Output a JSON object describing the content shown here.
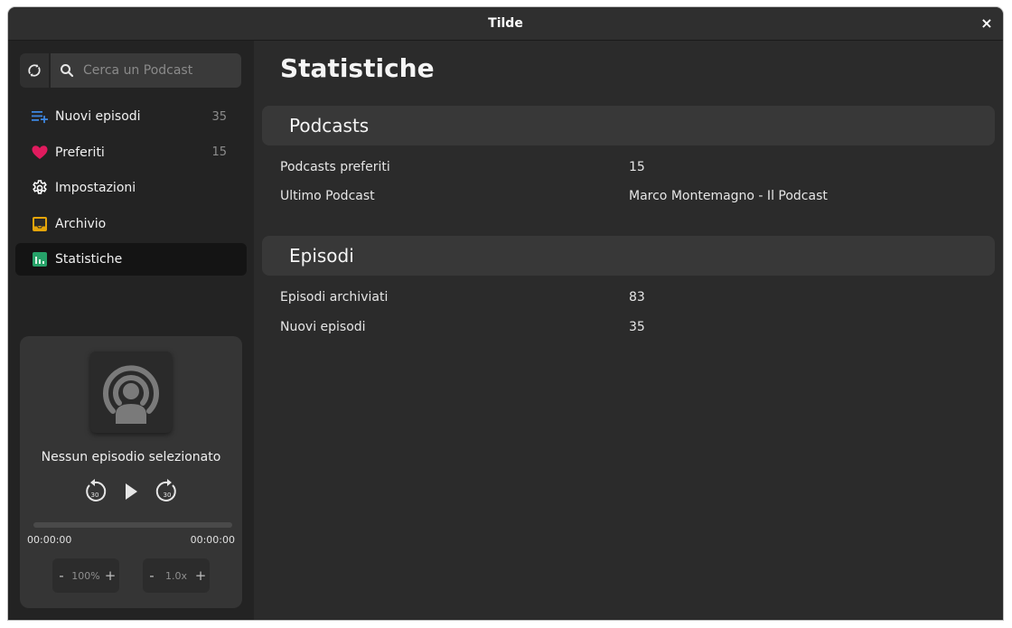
{
  "window": {
    "title": "Tilde",
    "close_symbol": "×"
  },
  "search": {
    "placeholder": "Cerca un Podcast"
  },
  "sidebar": {
    "items": [
      {
        "label": "Nuovi episodi",
        "count": "35",
        "icon": "new-episodes-icon",
        "color": "#3d86e0"
      },
      {
        "label": "Preferiti",
        "count": "15",
        "icon": "heart-icon",
        "color": "#e01b5e"
      },
      {
        "label": "Impostazioni",
        "count": "",
        "icon": "gear-icon",
        "color": "#ffffff"
      },
      {
        "label": "Archivio",
        "count": "",
        "icon": "inbox-icon",
        "color": "#e5a50a"
      },
      {
        "label": "Statistiche",
        "count": "",
        "icon": "stats-icon",
        "color": "#26a269",
        "active": true
      }
    ]
  },
  "player": {
    "episode_title": "Nessun episodio selezionato",
    "skip_back_label": "30",
    "skip_forward_label": "30",
    "current_time": "00:00:00",
    "total_time": "00:00:00",
    "progress": 0,
    "volume": "100%",
    "speed": "1.0x",
    "minus": "-",
    "plus": "+"
  },
  "main": {
    "title": "Statistiche",
    "sections": [
      {
        "header": "Podcasts",
        "rows": [
          {
            "label": "Podcasts preferiti",
            "value": "15"
          },
          {
            "label": "Ultimo Podcast",
            "value": "Marco Montemagno - Il Podcast"
          }
        ]
      },
      {
        "header": "Episodi",
        "rows": [
          {
            "label": "Episodi archiviati",
            "value": "83"
          },
          {
            "label": "Nuovi episodi",
            "value": "35"
          }
        ]
      }
    ]
  }
}
